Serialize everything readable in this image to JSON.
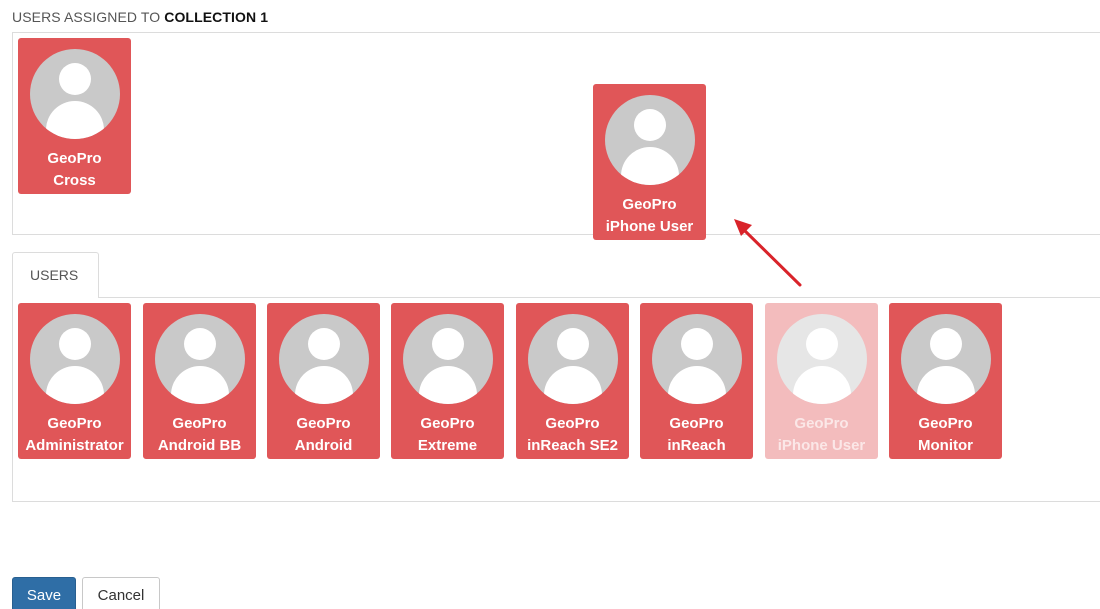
{
  "header": {
    "prefix": "USERS ASSIGNED TO",
    "collection_name": "COLLECTION 1"
  },
  "assigned_users": [
    {
      "line1": "GeoPro",
      "line2": "Cross"
    },
    {
      "line1": "GeoPro",
      "line2": "iPhone User"
    }
  ],
  "tabs": {
    "users_label": "USERS"
  },
  "users": [
    {
      "line1": "GeoPro",
      "line2": "Administrator"
    },
    {
      "line1": "GeoPro",
      "line2": "Android BB"
    },
    {
      "line1": "GeoPro",
      "line2": "Android"
    },
    {
      "line1": "GeoPro",
      "line2": "Extreme"
    },
    {
      "line1": "GeoPro",
      "line2": "inReach SE2"
    },
    {
      "line1": "GeoPro",
      "line2": "inReach"
    },
    {
      "line1": "GeoPro",
      "line2": "iPhone User",
      "state": "dragging-placeholder"
    },
    {
      "line1": "GeoPro",
      "line2": "Monitor"
    }
  ],
  "buttons": {
    "save": "Save",
    "cancel": "Cancel"
  },
  "icons": {
    "avatar": "user-silhouette-icon",
    "drag_indicator": "arrow-icon"
  },
  "colors": {
    "card": "#e05658",
    "card_faded": "#f3bcbd",
    "avatar_bg": "#c9c9c9",
    "arrow": "#d9232a",
    "save_button": "#2f6ea6"
  }
}
